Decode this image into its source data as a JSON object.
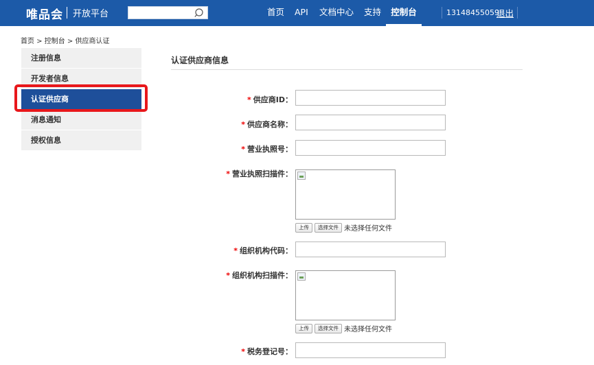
{
  "header": {
    "logo": "唯品会",
    "subtitle": "开放平台",
    "nav": [
      "首页",
      "API",
      "文档中心",
      "支持",
      "控制台"
    ],
    "phone": "13148455059",
    "logout": "退出"
  },
  "breadcrumb": "首页 > 控制台 > 供应商认证",
  "sidebar": {
    "items": [
      {
        "label": "注册信息"
      },
      {
        "label": "开发者信息"
      },
      {
        "label": "认证供应商"
      },
      {
        "label": "消息通知"
      },
      {
        "label": "授权信息"
      }
    ],
    "active_index": 2
  },
  "main": {
    "title": "认证供应商信息",
    "required_mark": "*",
    "fields": {
      "supplier_id": {
        "label": "供应商ID：",
        "value": ""
      },
      "supplier_name": {
        "label": "供应商名称：",
        "value": ""
      },
      "license_no": {
        "label": "营业执照号：",
        "value": ""
      },
      "license_scan": {
        "label": "营业执照扫描件："
      },
      "org_code": {
        "label": "组织机构代码：",
        "value": ""
      },
      "org_scan": {
        "label": "组织机构扫描件："
      },
      "tax_no": {
        "label": "税务登记号：",
        "value": ""
      }
    },
    "upload_button": "上传",
    "choose_file_button": "选择文件",
    "no_file_text": "未选择任何文件"
  },
  "colors": {
    "header_bg": "#1c5aa8",
    "active_item_bg": "#1e4f9a",
    "highlight": "#e8171b",
    "required": "#e00000"
  }
}
